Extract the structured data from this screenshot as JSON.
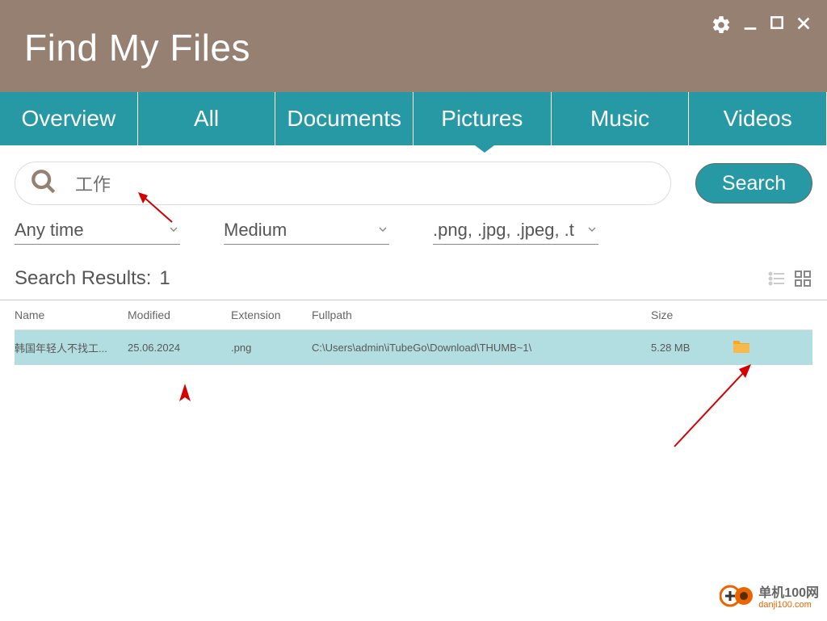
{
  "app": {
    "title": "Find My Files"
  },
  "tabs": {
    "items": [
      {
        "label": "Overview"
      },
      {
        "label": "All"
      },
      {
        "label": "Documents"
      },
      {
        "label": "Pictures"
      },
      {
        "label": "Music"
      },
      {
        "label": "Videos"
      }
    ],
    "active_index": 3
  },
  "search": {
    "value": "工作",
    "button_label": "Search"
  },
  "filters": {
    "time": "Any time",
    "size": "Medium",
    "ext": ".png, .jpg, .jpeg, .t"
  },
  "results": {
    "label": "Search Results:",
    "count": "1",
    "columns": {
      "name": "Name",
      "modified": "Modified",
      "extension": "Extension",
      "fullpath": "Fullpath",
      "size": "Size"
    },
    "rows": [
      {
        "name": "韩国年轻人不找工...",
        "modified": "25.06.2024",
        "extension": ".png",
        "fullpath": "C:\\Users\\admin\\iTubeGo\\Download\\THUMB~1\\",
        "size": "5.28 MB"
      }
    ]
  },
  "watermark": {
    "line1": "单机100网",
    "line2": "danji100.com"
  }
}
